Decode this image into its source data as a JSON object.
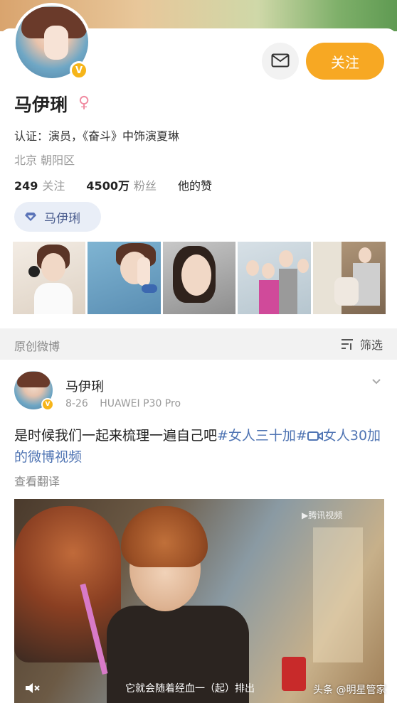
{
  "profile": {
    "name": "马伊琍",
    "verify_badge": "V",
    "verification": "认证：演员，《奋斗》中饰演夏琳",
    "location": "北京 朝阳区",
    "follow_button": "关注",
    "tag_chip": "马伊琍",
    "gender_icon": "female-symbol-icon",
    "message_icon": "message-icon"
  },
  "stats": {
    "following_count": "249",
    "following_label": "关注",
    "followers_count": "4500万",
    "followers_label": "粉丝",
    "likes_label": "他的赞"
  },
  "feed_header": {
    "title": "原创微博",
    "filter_label": "筛选"
  },
  "post": {
    "author": "马伊琍",
    "date": "8-26",
    "device": "HUAWEI P30 Pro",
    "text_plain": "是时候我们一起来梳理一遍自己吧",
    "hashtag": "#女人三十加#",
    "video_link": "女人30加的微博视频",
    "translate": "查看翻译",
    "video": {
      "subtitle": "它就会随着经血一（起）排出",
      "logo": "▶腾讯视频",
      "watermark": "头条 @明星管家"
    }
  },
  "colors": {
    "accent": "#f7a823",
    "link": "#4f74b3",
    "badge": "#f6b51a"
  }
}
